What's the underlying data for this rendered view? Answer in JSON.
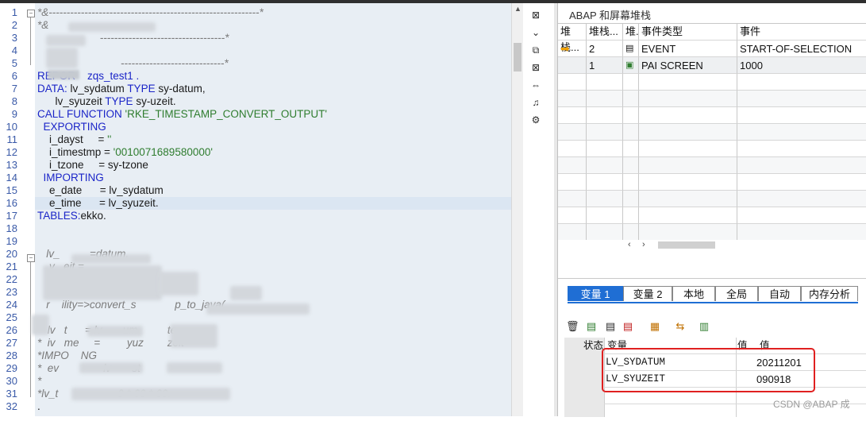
{
  "code_lines": [
    {
      "n": "1",
      "parts": [
        {
          "t": "*&-----------------------------------------------------------*",
          "c": "cm"
        }
      ]
    },
    {
      "n": "2",
      "parts": [
        {
          "t": "*&",
          "c": "cm"
        }
      ]
    },
    {
      "n": "3",
      "parts": [
        {
          "t": "                     -----------------------------------*",
          "c": "cm"
        }
      ]
    },
    {
      "n": "4",
      "parts": []
    },
    {
      "n": "5",
      "parts": [
        {
          "t": "                            -----------------------------*",
          "c": "cm"
        }
      ]
    },
    {
      "n": "6",
      "parts": [
        {
          "t": "REPOR    zqs_test1 .",
          "c": "kw"
        }
      ]
    },
    {
      "n": "7",
      "parts": [
        {
          "t": "DATA: ",
          "c": "kw"
        },
        {
          "t": "lv_sydatum ",
          "c": "tx"
        },
        {
          "t": "TYPE ",
          "c": "kw"
        },
        {
          "t": "sy-datum,",
          "c": "tx"
        }
      ]
    },
    {
      "n": "8",
      "parts": [
        {
          "t": "      lv_syuzeit ",
          "c": "tx"
        },
        {
          "t": "TYPE ",
          "c": "kw"
        },
        {
          "t": "sy-uzeit.",
          "c": "tx"
        }
      ]
    },
    {
      "n": "9",
      "parts": [
        {
          "t": "CALL FUNCTION ",
          "c": "kw"
        },
        {
          "t": "'RKE_TIMESTAMP_CONVERT_OUTPUT'",
          "c": "st"
        }
      ]
    },
    {
      "n": "10",
      "parts": [
        {
          "t": "  EXPORTING",
          "c": "kw"
        }
      ]
    },
    {
      "n": "11",
      "parts": [
        {
          "t": "    i_dayst     = ",
          "c": "tx"
        },
        {
          "t": "''",
          "c": "st"
        }
      ]
    },
    {
      "n": "12",
      "parts": [
        {
          "t": "    i_timestmp = ",
          "c": "tx"
        },
        {
          "t": "'0010071689580000'",
          "c": "st"
        }
      ]
    },
    {
      "n": "13",
      "parts": [
        {
          "t": "    i_tzone     = sy-tzone",
          "c": "tx"
        }
      ]
    },
    {
      "n": "14",
      "parts": [
        {
          "t": "  IMPORTING",
          "c": "kw"
        }
      ]
    },
    {
      "n": "15",
      "parts": [
        {
          "t": "    e_date      = lv_sydatum",
          "c": "tx"
        }
      ]
    },
    {
      "n": "16",
      "parts": [
        {
          "t": "    e_time      = lv_syuzeit.",
          "c": "tx"
        }
      ]
    },
    {
      "n": "17",
      "parts": [
        {
          "t": "TABLES:",
          "c": "kw"
        },
        {
          "t": "ekko.",
          "c": "tx"
        }
      ]
    },
    {
      "n": "18",
      "parts": []
    },
    {
      "n": "19",
      "parts": []
    },
    {
      "n": "20",
      "parts": [
        {
          "t": "   lv_          =datum.",
          "c": "cm"
        }
      ]
    },
    {
      "n": "21",
      "parts": [
        {
          "t": "    v   eit =",
          "c": "cm"
        }
      ]
    },
    {
      "n": "22",
      "parts": [
        {
          "t": "                          T    string",
          "c": "cm"
        }
      ]
    },
    {
      "n": "23",
      "parts": [
        {
          "t": "      d.                  TY",
          "c": "cm"
        }
      ]
    },
    {
      "n": "24",
      "parts": [
        {
          "t": "   r    ility=>convert_s             p_to_java(",
          "c": "cm"
        }
      ]
    },
    {
      "n": "25",
      "parts": []
    },
    {
      "n": "26",
      "parts": [
        {
          "t": "*  lv   t      = lv       um          te",
          "c": "cm"
        }
      ]
    },
    {
      "n": "27",
      "parts": [
        {
          "t": "*  iv   me     =         yuz        zeit",
          "c": "cm"
        }
      ]
    },
    {
      "n": "28",
      "parts": [
        {
          "t": "*IMPO    NG",
          "c": "cm"
        }
      ]
    },
    {
      "n": "29",
      "parts": [
        {
          "t": "*  ev               lv       st",
          "c": "cm"
        }
      ]
    },
    {
      "n": "30",
      "parts": [
        {
          "t": "*",
          "c": "cm"
        }
      ]
    },
    {
      "n": "31",
      "parts": [
        {
          "t": "*lv_t                    0 * 60 * 60.",
          "c": "cm"
        }
      ]
    },
    {
      "n": "32",
      "parts": [
        {
          "t": ".",
          "c": "tx"
        }
      ]
    }
  ],
  "stack": {
    "title": "ABAP 和屏幕堆栈",
    "headers": [
      "堆栈...",
      "堆栈...",
      "堆.",
      "事件类型",
      "事件"
    ],
    "rows": [
      {
        "level": "2",
        "type": "EVENT",
        "event": "START-OF-SELECTION",
        "current": true
      },
      {
        "level": "1",
        "type": "PAI SCREEN",
        "event": "1000",
        "current": false
      }
    ]
  },
  "vars": {
    "tabs": [
      "变量 1",
      "变量 2",
      "本地",
      "全局",
      "自动",
      "内存分析"
    ],
    "headers": {
      "status": "状态",
      "var": "变量",
      "v1": "值",
      "v2": "值"
    },
    "rows": [
      {
        "name": "LV_SYDATUM",
        "value": "20211201"
      },
      {
        "name": "LV_SYUZEIT",
        "value": "090918"
      }
    ]
  },
  "watermark": "CSDN @ABAP 成",
  "colors": {
    "accent": "#1f6ed4",
    "highlight_box": "#e02020",
    "keyword": "#1b25c8",
    "string": "#2f7d2f"
  }
}
